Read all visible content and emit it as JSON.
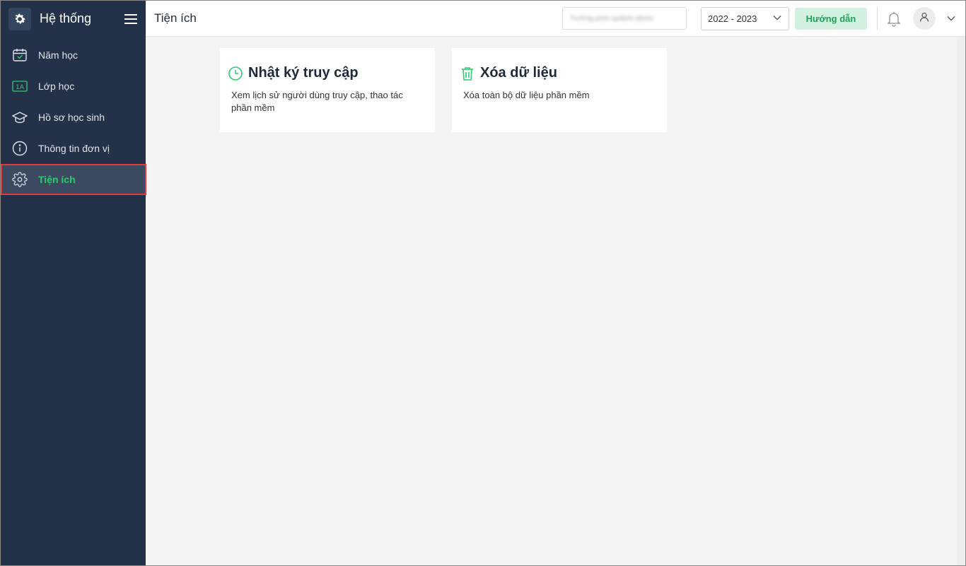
{
  "sidebar": {
    "title": "Hệ thống",
    "items": [
      {
        "label": "Năm học",
        "icon": "calendar-check-icon"
      },
      {
        "label": "Lớp học",
        "icon": "class-1a-icon"
      },
      {
        "label": "Hồ sơ học sinh",
        "icon": "graduation-cap-icon"
      },
      {
        "label": "Thông tin đơn vị",
        "icon": "info-icon"
      },
      {
        "label": "Tiện ích",
        "icon": "gear-icon",
        "active": true
      }
    ],
    "class_badge": "1A"
  },
  "topbar": {
    "title": "Tiện ích",
    "school_name": "Trường prim system demo",
    "year": "2022 - 2023",
    "guide_label": "Hướng dẫn"
  },
  "cards": [
    {
      "title": "Nhật ký truy cập",
      "description": "Xem lịch sử người dùng truy cập, thao tác phần mềm",
      "icon": "clock-icon"
    },
    {
      "title": "Xóa dữ liệu",
      "description": "Xóa toàn bộ dữ liệu phần mềm",
      "icon": "trash-icon"
    }
  ],
  "colors": {
    "sidebar_bg": "#233248",
    "accent_green": "#2ecc71",
    "guide_bg": "#d3f1e1",
    "highlight_red": "#e23b3b"
  }
}
